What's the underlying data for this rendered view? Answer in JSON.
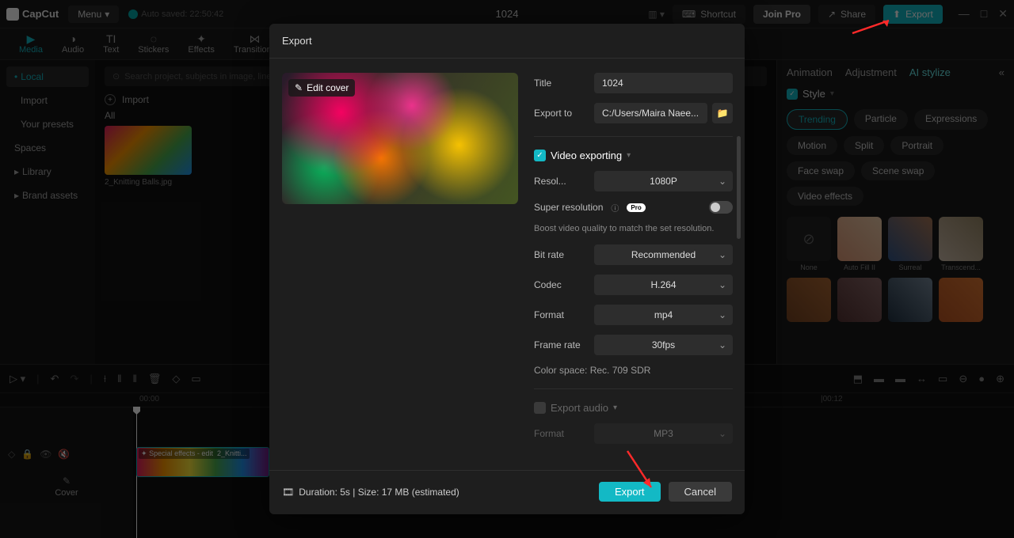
{
  "app": {
    "name": "CapCut",
    "autosave": "Auto saved: 22:50:42",
    "project": "1024"
  },
  "topbar": {
    "menu": "Menu",
    "shortcut": "Shortcut",
    "join_pro": "Join Pro",
    "share": "Share",
    "export": "Export"
  },
  "tool_tabs": [
    "Media",
    "Audio",
    "Text",
    "Stickers",
    "Effects",
    "Transitions"
  ],
  "sidebar": {
    "local": "Local",
    "import": "Import",
    "presets": "Your presets",
    "spaces": "Spaces",
    "library": "Library",
    "brand": "Brand assets"
  },
  "media": {
    "search_placeholder": "Search project, subjects in image, lines",
    "import": "Import",
    "all": "All",
    "thumb_name": "2_Knitting Balls.jpg"
  },
  "right_panel": {
    "tabs": {
      "animation": "Animation",
      "adjustment": "Adjustment",
      "ai": "AI stylize"
    },
    "style": "Style",
    "chips": [
      "Trending",
      "Particle",
      "Expressions",
      "Motion",
      "Split",
      "Portrait",
      "Face swap",
      "Scene swap",
      "Video effects"
    ],
    "presets": [
      "None",
      "Auto Fill II",
      "Surreal",
      "Transcend..."
    ]
  },
  "timeline": {
    "cover": "Cover",
    "clip_name": "2_Knitti...",
    "fx_label": "Special effects - edit",
    "t0": "00:00",
    "t12": "|00:12"
  },
  "modal": {
    "title": "Export",
    "edit_cover": "Edit cover",
    "title_label": "Title",
    "title_value": "1024",
    "export_to_label": "Export to",
    "export_to_value": "C:/Users/Maira Naee...",
    "video_section": "Video exporting",
    "resolution_label": "Resol...",
    "resolution_value": "1080P",
    "super_res": "Super resolution",
    "super_res_help": "Boost video quality to match the set resolution.",
    "bitrate_label": "Bit rate",
    "bitrate_value": "Recommended",
    "codec_label": "Codec",
    "codec_value": "H.264",
    "format_label": "Format",
    "format_value": "mp4",
    "framerate_label": "Frame rate",
    "framerate_value": "30fps",
    "color_space": "Color space: Rec. 709 SDR",
    "audio_section": "Export audio",
    "audio_format_label": "Format",
    "audio_format_value": "MP3",
    "duration": "Duration: 5s | Size: 17 MB (estimated)",
    "export_btn": "Export",
    "cancel_btn": "Cancel"
  }
}
